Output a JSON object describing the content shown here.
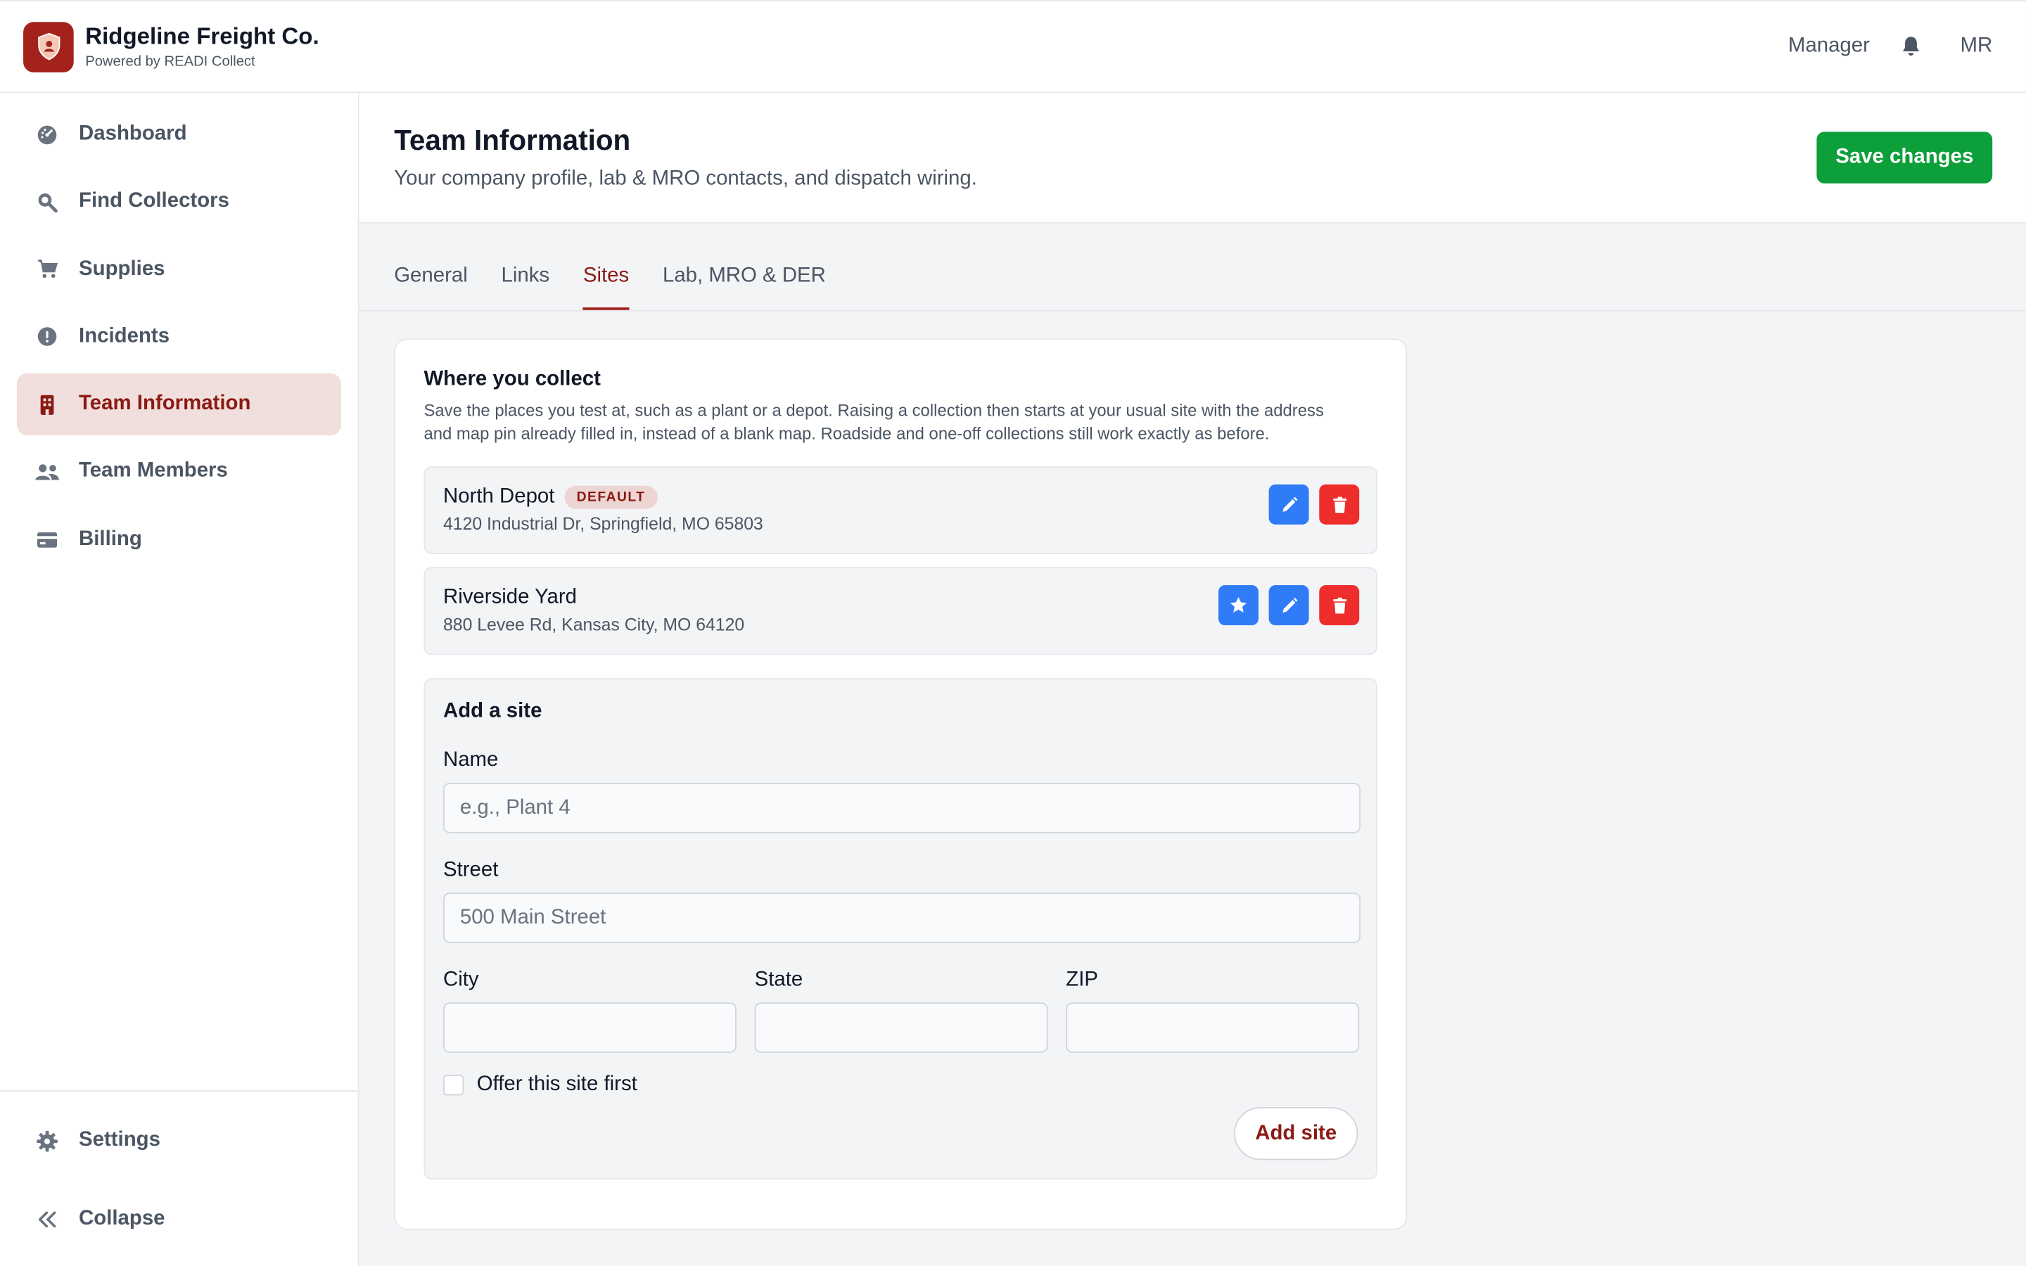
{
  "app": {
    "company_name": "Ridgeline Freight Co.",
    "powered_by": "Powered by READI Collect",
    "brand_color": "#a3231c"
  },
  "topbar": {
    "role": "Manager",
    "notifications_icon": "bell-icon",
    "user_initials": "MR"
  },
  "sidebar": {
    "items": [
      {
        "label": "Dashboard",
        "icon": "dashboard-gauge-icon",
        "active": false
      },
      {
        "label": "Find Collectors",
        "icon": "search-icon",
        "active": false
      },
      {
        "label": "Supplies",
        "icon": "cart-icon",
        "active": false
      },
      {
        "label": "Incidents",
        "icon": "alert-circle-icon",
        "active": true
      },
      {
        "label": "Team Information",
        "icon": "building-icon",
        "active": true
      },
      {
        "label": "Team Members",
        "icon": "users-icon",
        "active": false
      },
      {
        "label": "Billing",
        "icon": "credit-card-icon",
        "active": false
      }
    ],
    "bottom": [
      {
        "label": "Settings",
        "icon": "gear-icon"
      },
      {
        "label": "Collapse",
        "icon": "chevrons-left-icon"
      }
    ]
  },
  "page": {
    "title": "Team Information",
    "subtitle": "Your company profile, lab & MRO contacts, and dispatch wiring.",
    "save_label": "Save changes",
    "save_color": "#0d9f3a"
  },
  "tabs": [
    {
      "label": "General",
      "active": false
    },
    {
      "label": "Links",
      "active": false
    },
    {
      "label": "Sites",
      "active": true
    },
    {
      "label": "Lab, MRO & DER",
      "active": false
    }
  ],
  "sites_card": {
    "title": "Where you collect",
    "description": "Save the places you test at, such as a plant or a depot. Raising a collection then starts at your usual site with the address and map pin already filled in, instead of a blank map. Roadside and one-off collections still work exactly as before.",
    "sites": [
      {
        "name": "North Depot",
        "badge": "DEFAULT",
        "address": "4120 Industrial Dr, Springfield, MO 65803",
        "actions": [
          "edit",
          "delete"
        ]
      },
      {
        "name": "Riverside Yard",
        "badge": "",
        "address": "880 Levee Rd, Kansas City, MO 64120",
        "actions": [
          "make-default",
          "edit",
          "delete"
        ]
      }
    ]
  },
  "add_site": {
    "title": "Add a site",
    "name_label": "Name",
    "name_placeholder": "e.g., Plant 4",
    "street_label": "Street",
    "street_placeholder": "500 Main Street",
    "city_label": "City",
    "state_label": "State",
    "zip_label": "ZIP",
    "city_value": "",
    "state_value": "",
    "zip_value": "",
    "offer_first_label": "Offer this site first",
    "offer_first_checked": false,
    "submit_label": "Add site"
  }
}
